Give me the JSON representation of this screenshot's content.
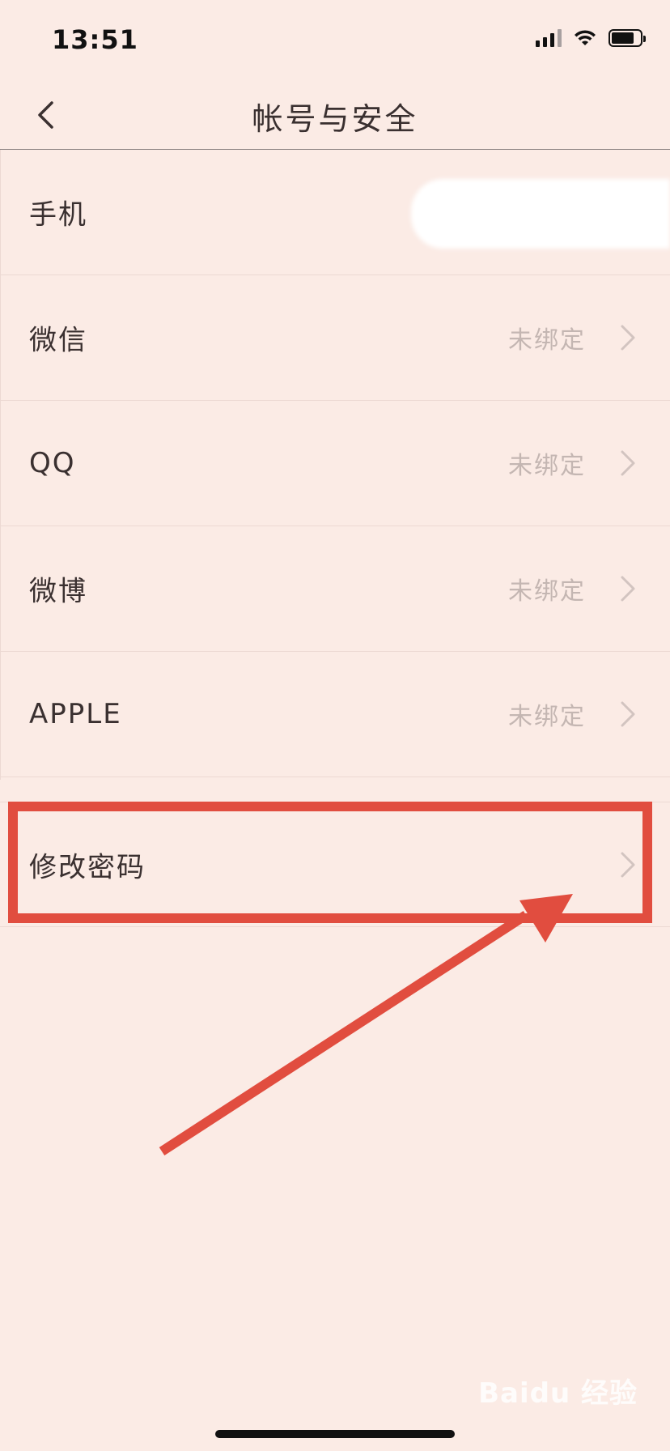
{
  "status_bar": {
    "time": "13:51"
  },
  "nav": {
    "title": "帐号与安全"
  },
  "rows": [
    {
      "label": "手机",
      "value": ""
    },
    {
      "label": "微信",
      "value": "未绑定"
    },
    {
      "label": "QQ",
      "value": "未绑定"
    },
    {
      "label": "微博",
      "value": "未绑定"
    },
    {
      "label": "APPLE",
      "value": "未绑定"
    }
  ],
  "password_row": {
    "label": "修改密码"
  },
  "watermark": {
    "text": "Baidu 经验"
  },
  "colors": {
    "background": "#fbebe5",
    "highlight": "#e14d3f",
    "muted_text": "#c4b6b2"
  },
  "icons": {
    "back": "chevron-left-icon",
    "row_arrow": "chevron-right-icon"
  }
}
